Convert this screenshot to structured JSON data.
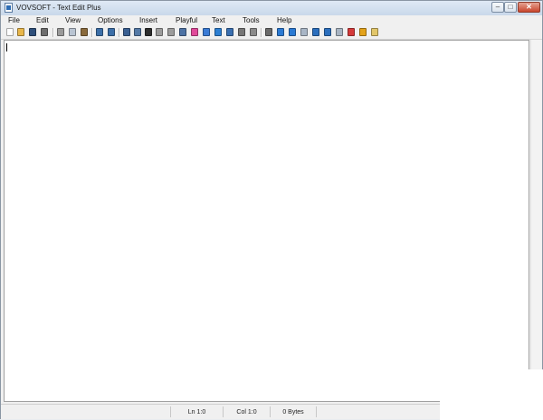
{
  "window": {
    "title": "VOVSOFT - Text Edit Plus",
    "controls": {
      "minimize": "–",
      "maximize": "□",
      "close": "✕"
    }
  },
  "menu": [
    "File",
    "Edit",
    "View",
    "Options",
    "Insert",
    "Playful",
    "Text",
    "Tools",
    "Help"
  ],
  "toolbar": {
    "buttons": [
      {
        "name": "new-file-icon",
        "color": "#ffffff"
      },
      {
        "name": "open-folder-icon",
        "color": "#e8b64a"
      },
      {
        "name": "save-icon",
        "color": "#2f4f7a"
      },
      {
        "name": "print-icon",
        "color": "#6d6d6d"
      },
      {
        "name": "cut-icon",
        "color": "#9a9a9a"
      },
      {
        "name": "copy-icon",
        "color": "#b9c4d2"
      },
      {
        "name": "paste-icon",
        "color": "#8a6a3c"
      },
      {
        "name": "find-icon",
        "color": "#3c6fa8"
      },
      {
        "name": "replace-icon",
        "color": "#3c6fa8"
      },
      {
        "name": "word-count-icon",
        "color": "#3a5f91"
      },
      {
        "name": "text-stats-icon",
        "color": "#557aa6"
      },
      {
        "name": "font-icon",
        "color": "#2e2e2e"
      },
      {
        "name": "lock-icon",
        "color": "#9c9c9c"
      },
      {
        "name": "unlock-icon",
        "color": "#9c9c9c"
      },
      {
        "name": "encode-icon",
        "color": "#4d72a4"
      },
      {
        "name": "color-wheel-icon",
        "color": "#e04a9a"
      },
      {
        "name": "pen-icon",
        "color": "#3a7bd5"
      },
      {
        "name": "filter-icon",
        "color": "#2d7fd2"
      },
      {
        "name": "at-icon",
        "color": "#3a6fb0"
      },
      {
        "name": "list-icon",
        "color": "#777777"
      },
      {
        "name": "keyboard-icon",
        "color": "#8a8a8a"
      },
      {
        "name": "sort-icon",
        "color": "#6a6a6a"
      },
      {
        "name": "arrow-right-icon",
        "color": "#2b7ad3"
      },
      {
        "name": "arrow-down-icon",
        "color": "#2b7ad3"
      },
      {
        "name": "document-icon",
        "color": "#a9b6c6"
      },
      {
        "name": "upload-icon",
        "color": "#2c6fbd"
      },
      {
        "name": "download-icon",
        "color": "#2c6fbd"
      },
      {
        "name": "page-icon",
        "color": "#a8b4c2"
      },
      {
        "name": "calendar-icon",
        "color": "#d43a3a"
      },
      {
        "name": "warning-icon",
        "color": "#e3a21a"
      },
      {
        "name": "note-icon",
        "color": "#e2c66a"
      }
    ]
  },
  "editor": {
    "content": ""
  },
  "status": {
    "line": "Ln 1:0",
    "column": "Col 1:0",
    "size": "0 Bytes"
  }
}
